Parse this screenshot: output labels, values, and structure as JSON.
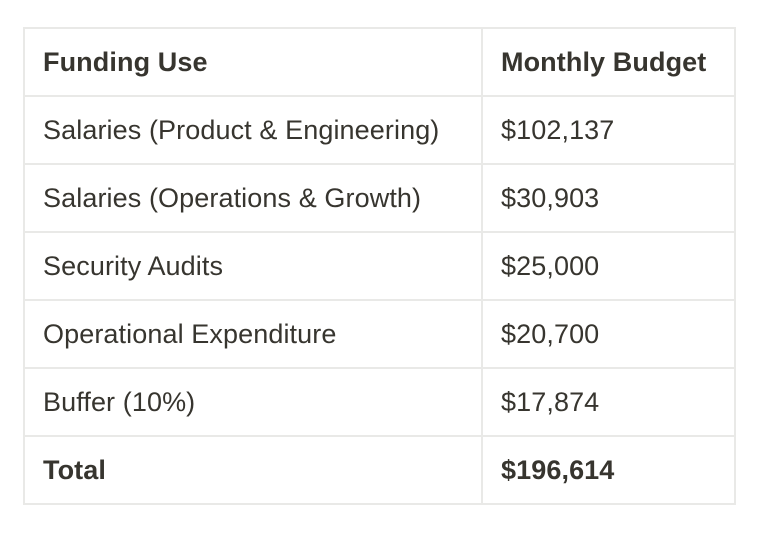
{
  "table": {
    "headers": [
      "Funding Use",
      "Monthly Budget"
    ],
    "rows": [
      [
        "Salaries (Product & Engineering)",
        "$102,137"
      ],
      [
        "Salaries (Operations & Growth)",
        "$30,903"
      ],
      [
        "Security Audits",
        "$25,000"
      ],
      [
        "Operational Expenditure",
        "$20,700"
      ],
      [
        "Buffer (10%)",
        "$17,874"
      ]
    ],
    "total": [
      "Total",
      "$196,614"
    ]
  }
}
